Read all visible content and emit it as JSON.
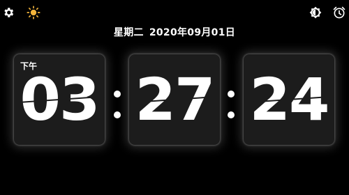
{
  "header": {
    "left_icons": [
      "gear-icon",
      "sun-icon"
    ],
    "right_icons": [
      "brightness-contrast-icon",
      "alarm-clock-icon"
    ],
    "sun_color": "#F2B43B"
  },
  "date": {
    "weekday": "星期二",
    "date": "2020年09月01日"
  },
  "clock": {
    "ampm": "下午",
    "hours": "03",
    "minutes": "27",
    "seconds": "24"
  },
  "colors": {
    "background": "#000000",
    "card": "#1C1C1C",
    "text": "#FFFFFF"
  }
}
